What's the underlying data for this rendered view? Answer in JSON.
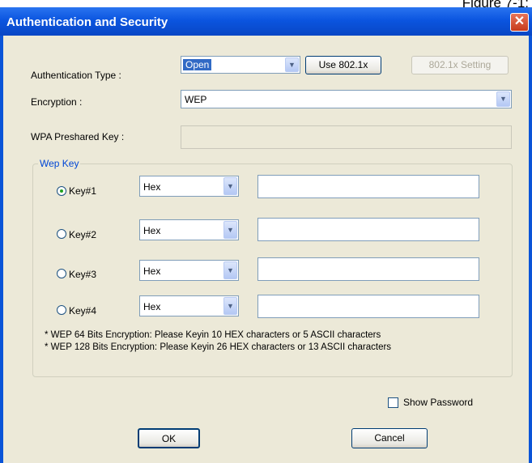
{
  "caption_fragment": "Figure 7-1:",
  "window": {
    "title": "Authentication and Security",
    "close_glyph": "✕"
  },
  "auth_type": {
    "label": "Authentication Type :",
    "value": "Open",
    "use_8021x_label": "Use 802.1x",
    "setting_8021x_label": "802.1x Setting"
  },
  "encryption": {
    "label": "Encryption :",
    "value": "WEP"
  },
  "wpa": {
    "label": "WPA Preshared Key :",
    "value": ""
  },
  "wep": {
    "group_title": "Wep Key",
    "keys": [
      {
        "label": "Key#1",
        "format": "Hex",
        "value": "",
        "selected": true
      },
      {
        "label": "Key#2",
        "format": "Hex",
        "value": "",
        "selected": false
      },
      {
        "label": "Key#3",
        "format": "Hex",
        "value": "",
        "selected": false
      },
      {
        "label": "Key#4",
        "format": "Hex",
        "value": "",
        "selected": false
      }
    ],
    "note_64": "* WEP 64 Bits Encryption:  Please Keyin 10 HEX characters or 5 ASCII characters",
    "note_128": "* WEP 128 Bits Encryption:  Please Keyin 26 HEX characters or 13 ASCII characters"
  },
  "show_password": {
    "label": "Show Password",
    "checked": false
  },
  "buttons": {
    "ok_label": "OK",
    "cancel_label": "Cancel"
  },
  "colors": {
    "title_bar": "#0b55e0",
    "dialog_bg": "#ece9d8",
    "group_title": "#0046d5",
    "selected_highlight": "#316ac5"
  },
  "icons": {
    "dropdown": "chevron-down-icon",
    "close": "close-icon"
  }
}
